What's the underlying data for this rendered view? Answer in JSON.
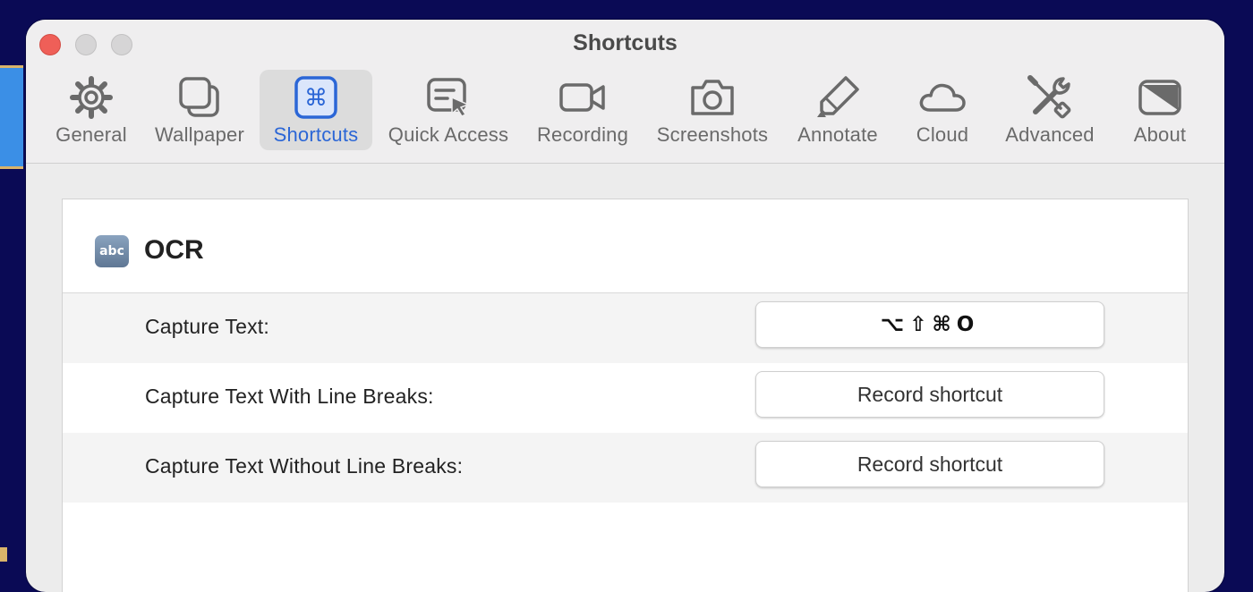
{
  "window": {
    "title": "Shortcuts"
  },
  "toolbar": {
    "tabs": [
      {
        "label": "General",
        "icon": "gear-icon"
      },
      {
        "label": "Wallpaper",
        "icon": "wallpaper-icon"
      },
      {
        "label": "Shortcuts",
        "icon": "command-icon",
        "selected": true
      },
      {
        "label": "Quick Access",
        "icon": "quick-access-icon"
      },
      {
        "label": "Recording",
        "icon": "video-camera-icon"
      },
      {
        "label": "Screenshots",
        "icon": "camera-icon"
      },
      {
        "label": "Annotate",
        "icon": "highlighter-icon"
      },
      {
        "label": "Cloud",
        "icon": "cloud-icon"
      },
      {
        "label": "Advanced",
        "icon": "tools-icon"
      },
      {
        "label": "About",
        "icon": "about-icon"
      }
    ]
  },
  "section": {
    "icon_text": "abc",
    "title": "OCR",
    "rows": [
      {
        "label": "Capture Text:",
        "shortcut": "⌥⇧⌘O"
      },
      {
        "label": "Capture Text With Line Breaks:",
        "shortcut": "Record shortcut"
      },
      {
        "label": "Capture Text Without Line Breaks:",
        "shortcut": "Record shortcut"
      }
    ]
  },
  "colors": {
    "accent": "#2b66d6",
    "close": "#ef5f58"
  }
}
